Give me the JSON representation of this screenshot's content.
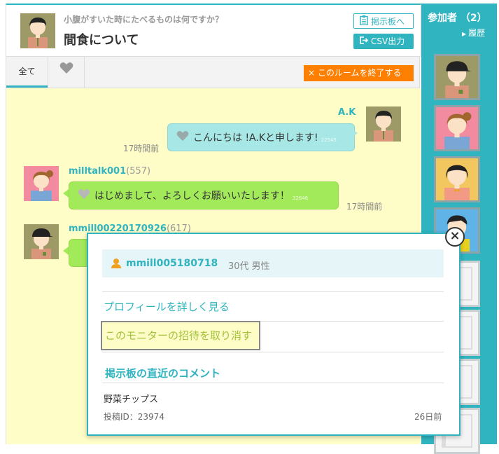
{
  "room": {
    "subtitle": "小腹がすいた時にたべるものは何ですか？",
    "title": "間食について",
    "bbs_button": "掲示板へ",
    "csv_button": "CSV出力"
  },
  "tabs": {
    "all_label": "全て",
    "end_room_button": "× このルームを終了する"
  },
  "messages": [
    {
      "user": "A.K",
      "text": "こんにちは !A.Kと申します!",
      "likes": "22545",
      "time": "17時間前"
    },
    {
      "user": "milltalk001",
      "count": "(557)",
      "text": "はじめまして、よろしくお願いいたします！",
      "likes": "32646",
      "time": "17時間前"
    },
    {
      "user": "mmill00220170926",
      "count": "(617)"
    }
  ],
  "sidebar": {
    "title": "参加者 （2）",
    "history": "履歴"
  },
  "popup": {
    "user_name": "mmill005180718",
    "user_info": "30代 男性",
    "profile_link": "プロフィールを詳しく見る",
    "cancel_invite": "このモニターの招待を取り消す",
    "recent_title": "掲示板の直近のコメント",
    "comment_text": "野菜チップス",
    "comment_id": "投稿ID：23974",
    "comment_time": "26日前",
    "close_symbol": "×"
  },
  "colors": {
    "accent": "#2fb4c0",
    "orange": "#ff7f00",
    "chat_background": "#fffdc7",
    "bubble_blue": "#a7e8e6",
    "bubble_green": "#a3ea5b"
  }
}
